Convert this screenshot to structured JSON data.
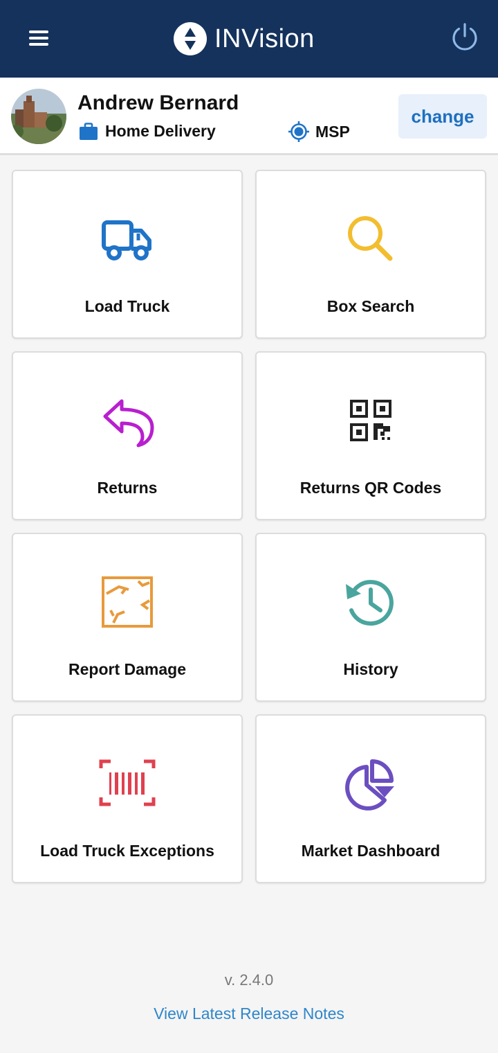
{
  "header": {
    "app_name": "INVision",
    "menu_icon": "hamburger-menu-icon",
    "logo_icon": "invision-logo-icon",
    "power_icon": "power-icon",
    "bg_color": "#14325c"
  },
  "profile": {
    "name": "Andrew Bernard",
    "department": "Home Delivery",
    "department_icon": "briefcase-icon",
    "location": "MSP",
    "location_icon": "crosshair-location-icon",
    "change_label": "change"
  },
  "tiles": [
    {
      "label": "Load Truck",
      "icon": "truck-icon",
      "color": "#1f74c8"
    },
    {
      "label": "Box Search",
      "icon": "magnifier-icon",
      "color": "#f2bd2f"
    },
    {
      "label": "Returns",
      "icon": "return-arrow-icon",
      "color": "#b81fcf"
    },
    {
      "label": "Returns QR Codes",
      "icon": "qr-code-icon",
      "color": "#222222"
    },
    {
      "label": "Report Damage",
      "icon": "damaged-box-icon",
      "color": "#e89a3c"
    },
    {
      "label": "History",
      "icon": "history-clock-icon",
      "color": "#4aa59e"
    },
    {
      "label": "Load Truck Exceptions",
      "icon": "barcode-scan-icon",
      "color": "#e0414f"
    },
    {
      "label": "Market Dashboard",
      "icon": "pie-chart-icon",
      "color": "#6b4fc0"
    }
  ],
  "footer": {
    "version": "v. 2.4.0",
    "release_notes_link": "View Latest Release Notes"
  }
}
